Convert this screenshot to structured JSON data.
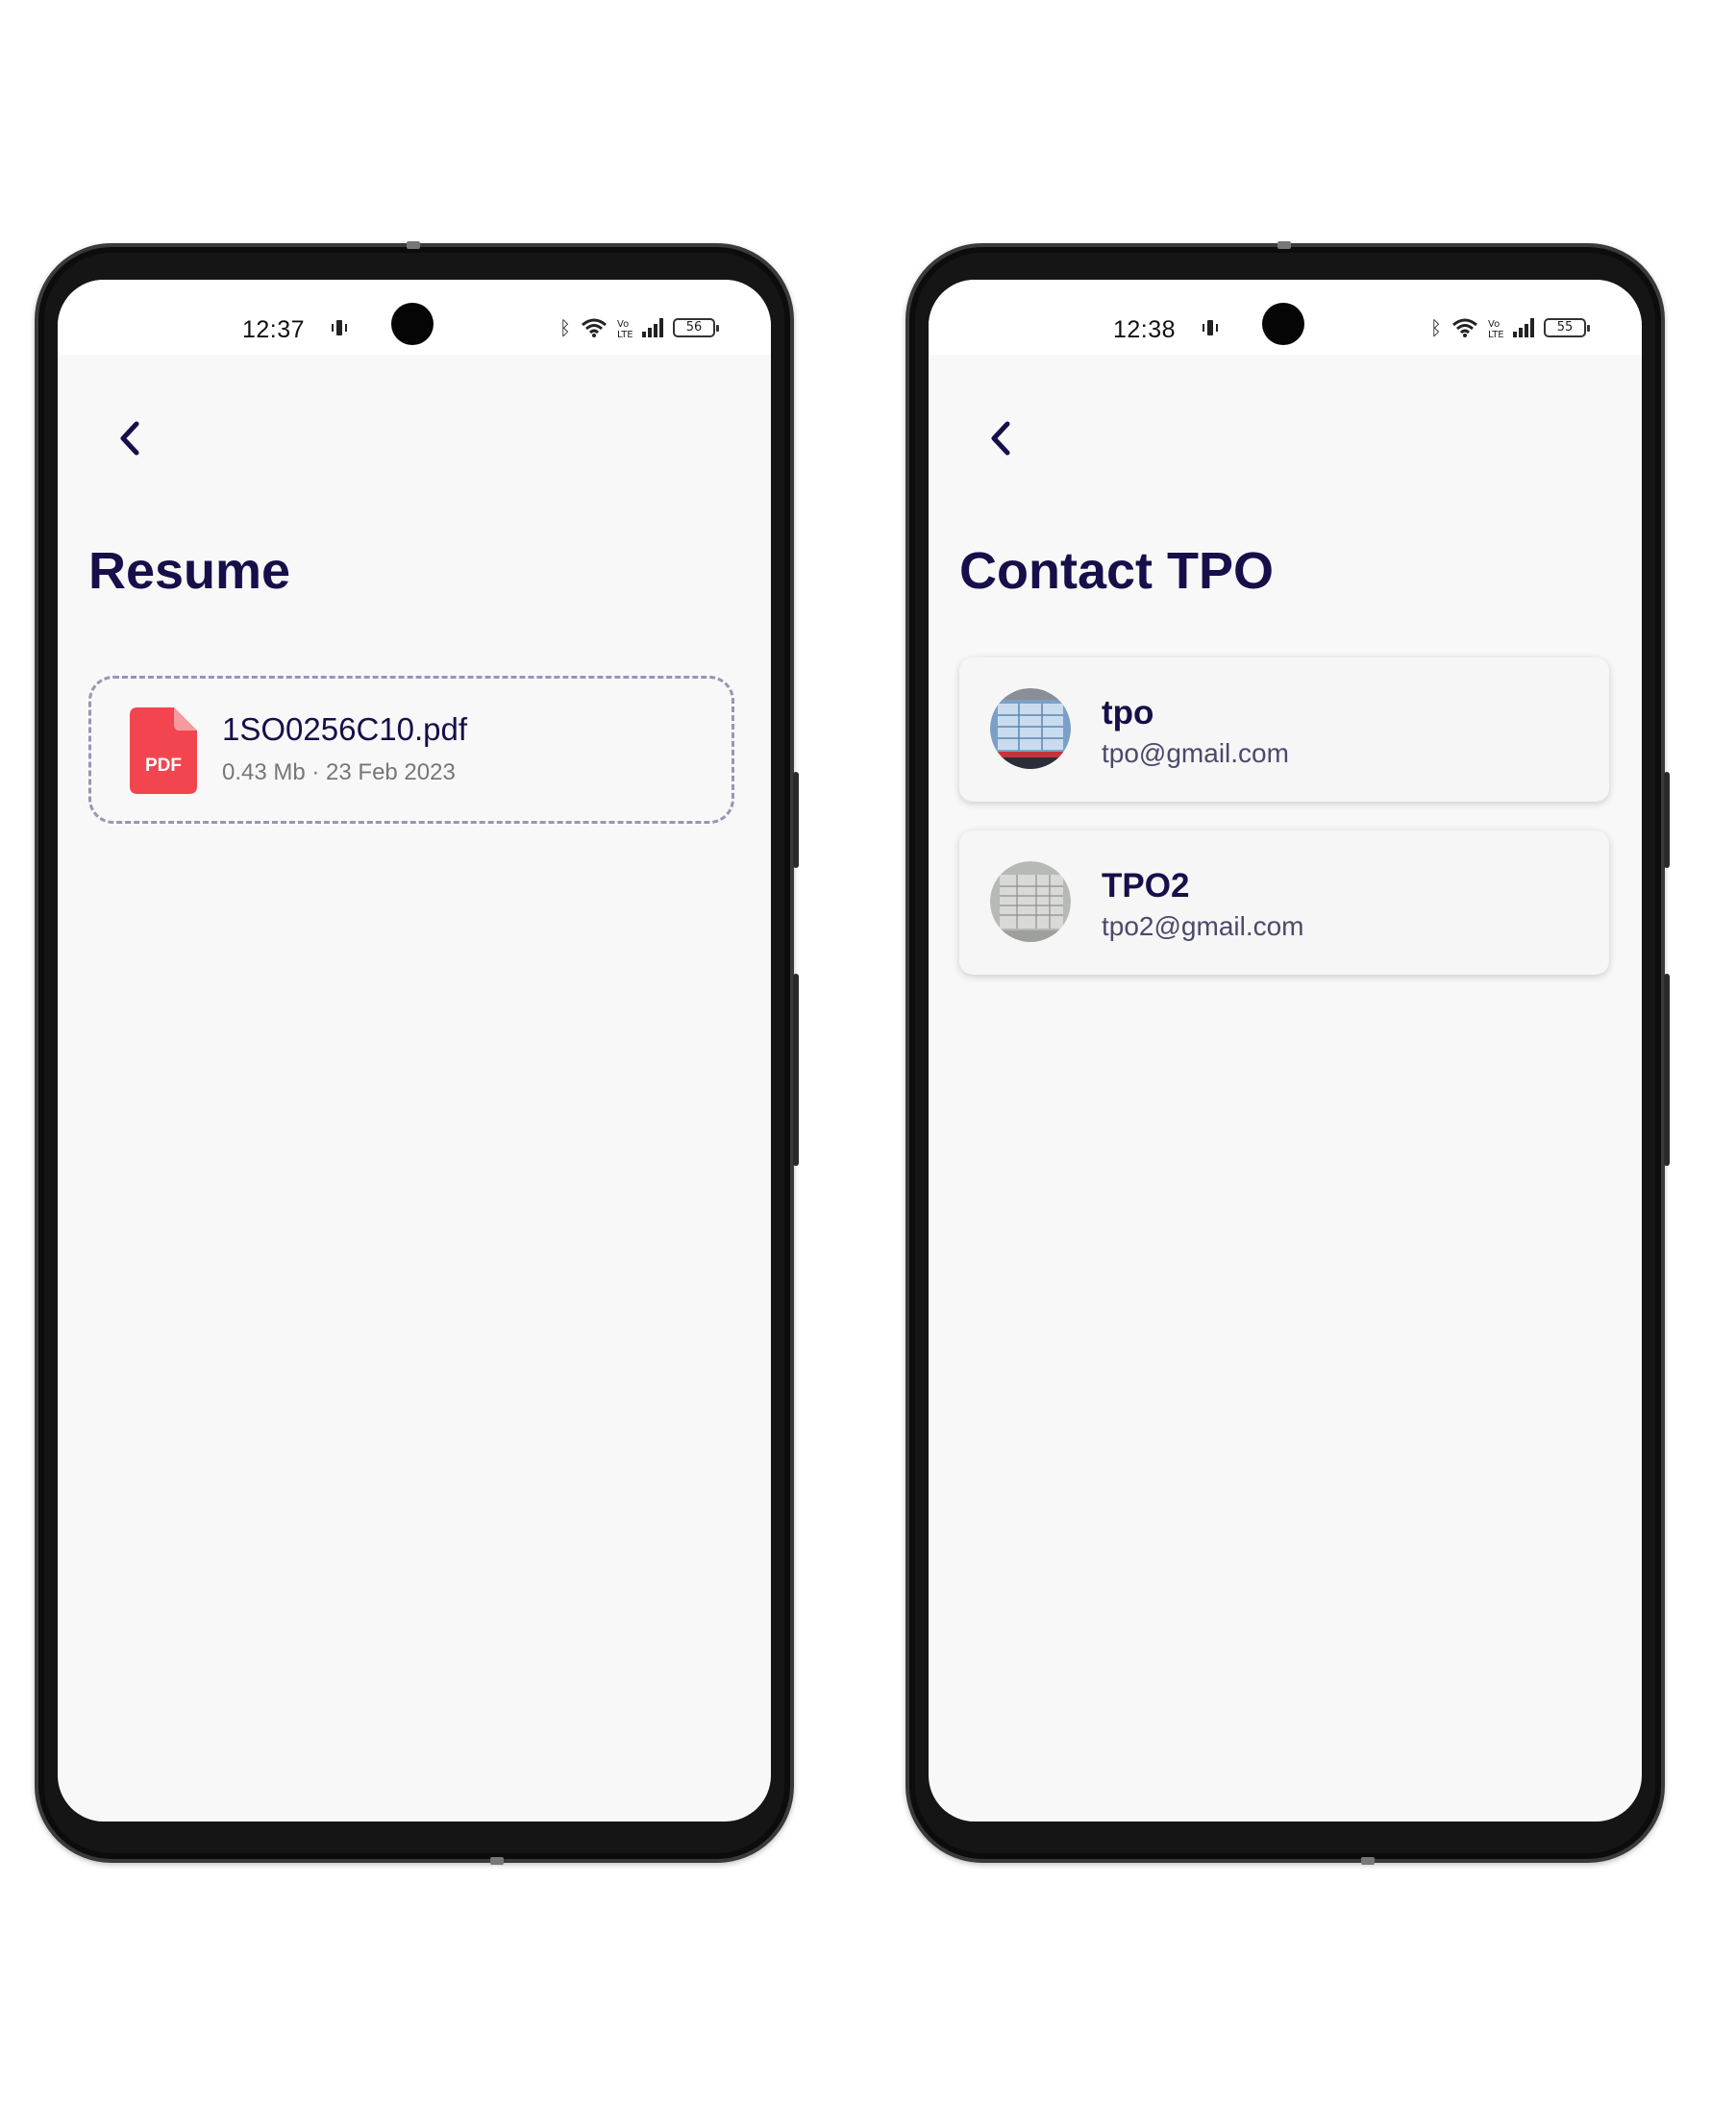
{
  "left_phone": {
    "status": {
      "time": "12:37",
      "battery": "56"
    },
    "screen": {
      "title": "Resume",
      "file": {
        "icon_label": "PDF",
        "name": "1SO0256C10.pdf",
        "meta": "0.43 Mb · 23 Feb 2023"
      }
    }
  },
  "right_phone": {
    "status": {
      "time": "12:38",
      "battery": "55"
    },
    "screen": {
      "title": "Contact TPO",
      "contacts": [
        {
          "name": "tpo",
          "email": "tpo@gmail.com"
        },
        {
          "name": "TPO2",
          "email": "tpo2@gmail.com"
        }
      ]
    }
  },
  "colors": {
    "title": "#160f4a",
    "pdf_red": "#f2454f",
    "dashed_border": "#9a94b6",
    "screen_bg": "#f8f8f8"
  },
  "icons": {
    "back": "chevron-left-icon",
    "status": [
      "vibrate-icon",
      "bluetooth-icon",
      "wifi-icon",
      "volte-icon",
      "signal-icon",
      "battery-icon"
    ],
    "file": "pdf-file-icon"
  }
}
